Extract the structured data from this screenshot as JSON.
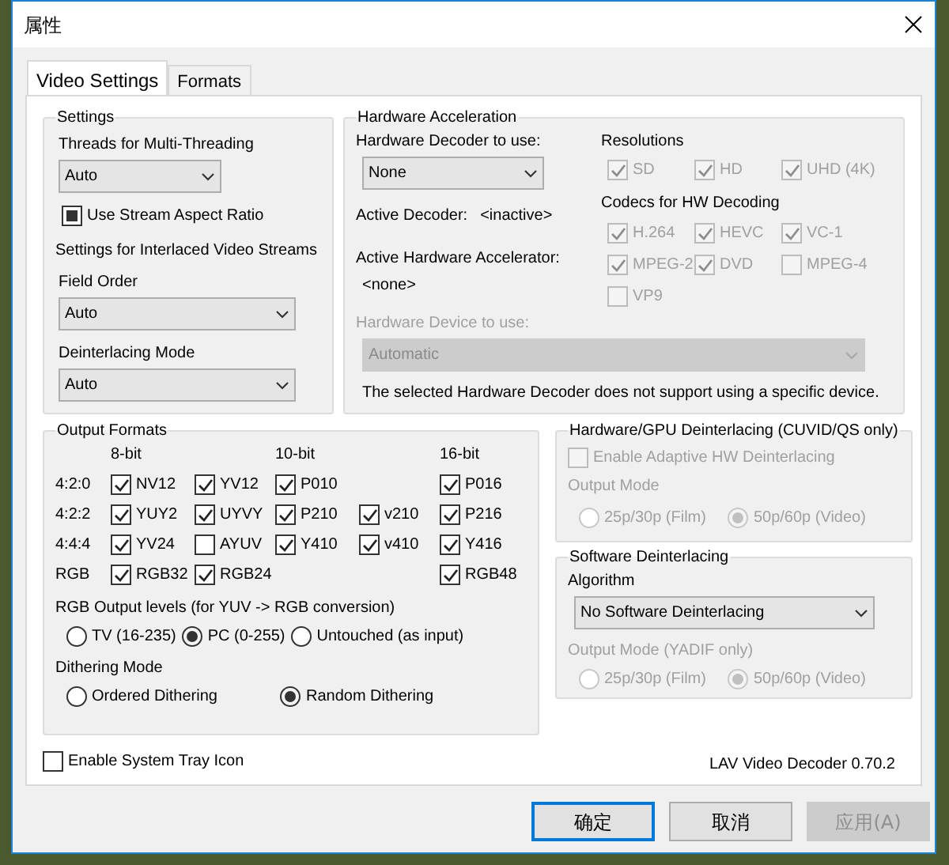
{
  "window": {
    "title": "属性"
  },
  "tabs": [
    {
      "label": "Video Settings",
      "selected": true
    },
    {
      "label": "Formats",
      "selected": false
    }
  ],
  "settings": {
    "title": "Settings",
    "threads_label": "Threads for Multi-Threading",
    "threads_value": "Auto",
    "aspect_ratio": {
      "label": "Use Stream Aspect Ratio",
      "checked": true,
      "indeterminate": true
    },
    "interlaced_title": "Settings for Interlaced Video Streams",
    "field_order_label": "Field Order",
    "field_order_value": "Auto",
    "deinterlacing_label": "Deinterlacing Mode",
    "deinterlacing_value": "Auto"
  },
  "hardware": {
    "title": "Hardware Acceleration",
    "decoder_label": "Hardware Decoder to use:",
    "decoder_value": "None",
    "active_decoder_label": "Active Decoder:",
    "active_decoder_value": "<inactive>",
    "accelerator_label": "Active Hardware Accelerator:",
    "accelerator_value": "<none>",
    "device_label": "Hardware Device to use:",
    "device_value": "Automatic",
    "device_disabled": true,
    "note": "The selected Hardware Decoder does not support using a specific device.",
    "resolutions_title": "Resolutions",
    "resolutions": [
      {
        "label": "SD",
        "checked": true,
        "disabled": true
      },
      {
        "label": "HD",
        "checked": true,
        "disabled": true
      },
      {
        "label": "UHD (4K)",
        "checked": true,
        "disabled": true
      }
    ],
    "codecs_title": "Codecs for HW Decoding",
    "codecs": [
      {
        "label": "H.264",
        "checked": true,
        "disabled": true
      },
      {
        "label": "HEVC",
        "checked": true,
        "disabled": true
      },
      {
        "label": "VC-1",
        "checked": true,
        "disabled": true
      },
      {
        "label": "MPEG-2",
        "checked": true,
        "disabled": true
      },
      {
        "label": "DVD",
        "checked": true,
        "disabled": true
      },
      {
        "label": "MPEG-4",
        "checked": false,
        "disabled": true
      },
      {
        "label": "VP9",
        "checked": false,
        "disabled": true
      }
    ]
  },
  "output_formats": {
    "title": "Output Formats",
    "headers": [
      "8-bit",
      "10-bit",
      "16-bit"
    ],
    "rows": [
      {
        "label": "4:2:0",
        "cells": [
          {
            "label": "NV12",
            "checked": true
          },
          {
            "label": "YV12",
            "checked": true
          },
          {
            "label": "P010",
            "checked": true
          },
          null,
          {
            "label": "P016",
            "checked": true
          }
        ]
      },
      {
        "label": "4:2:2",
        "cells": [
          {
            "label": "YUY2",
            "checked": true
          },
          {
            "label": "UYVY",
            "checked": true
          },
          {
            "label": "P210",
            "checked": true
          },
          {
            "label": "v210",
            "checked": true
          },
          {
            "label": "P216",
            "checked": true
          }
        ]
      },
      {
        "label": "4:4:4",
        "cells": [
          {
            "label": "YV24",
            "checked": true
          },
          {
            "label": "AYUV",
            "checked": false
          },
          {
            "label": "Y410",
            "checked": true
          },
          {
            "label": "v410",
            "checked": true
          },
          {
            "label": "Y416",
            "checked": true
          }
        ]
      },
      {
        "label": "RGB",
        "cells": [
          {
            "label": "RGB32",
            "checked": true
          },
          {
            "label": "RGB24",
            "checked": true
          },
          null,
          null,
          {
            "label": "RGB48",
            "checked": true
          }
        ]
      }
    ],
    "levels_label": "RGB Output levels (for YUV -> RGB conversion)",
    "levels": [
      {
        "label": "TV (16-235)",
        "selected": false
      },
      {
        "label": "PC (0-255)",
        "selected": true
      },
      {
        "label": "Untouched (as input)",
        "selected": false
      }
    ],
    "dithering_label": "Dithering Mode",
    "dithering": [
      {
        "label": "Ordered Dithering",
        "selected": false
      },
      {
        "label": "Random Dithering",
        "selected": true
      }
    ]
  },
  "hw_deinterlacing": {
    "title": "Hardware/GPU Deinterlacing (CUVID/QS only)",
    "enable": {
      "label": "Enable Adaptive HW Deinterlacing",
      "checked": false,
      "disabled": true
    },
    "output_mode_label": "Output Mode",
    "disabled": true,
    "modes": [
      {
        "label": "25p/30p (Film)",
        "selected": false
      },
      {
        "label": "50p/60p (Video)",
        "selected": true
      }
    ]
  },
  "sw_deinterlacing": {
    "title": "Software Deinterlacing",
    "algorithm_label": "Algorithm",
    "algorithm_value": "No Software Deinterlacing",
    "output_mode_label": "Output Mode (YADIF only)",
    "disabled": true,
    "modes": [
      {
        "label": "25p/30p (Film)",
        "selected": false
      },
      {
        "label": "50p/60p (Video)",
        "selected": true
      }
    ]
  },
  "tray": {
    "label": "Enable System Tray Icon",
    "checked": false
  },
  "version": "LAV Video Decoder 0.70.2",
  "buttons": [
    {
      "label": "确定",
      "default": true,
      "disabled": false
    },
    {
      "label": "取消",
      "default": false,
      "disabled": false
    },
    {
      "label": "应用(A)",
      "default": false,
      "disabled": true
    }
  ]
}
